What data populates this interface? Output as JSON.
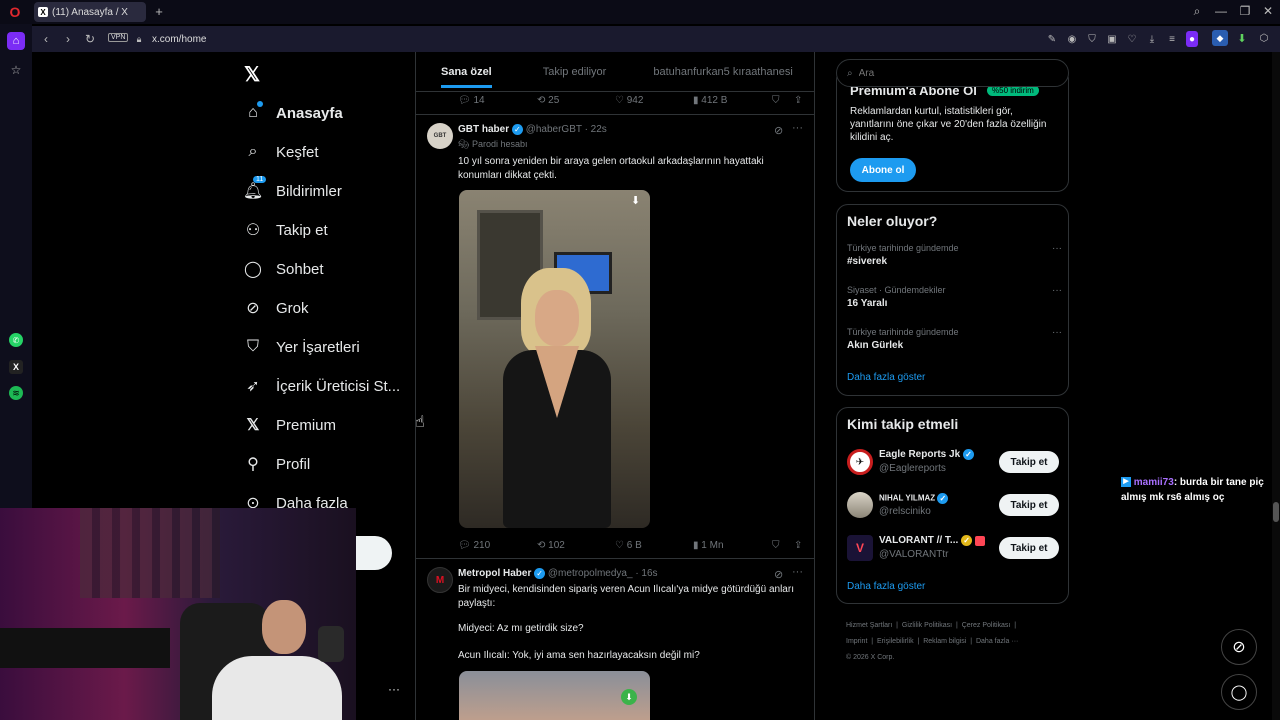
{
  "browser": {
    "tab_title": "(11) Anasayfa / X",
    "url": "x.com/home",
    "vpn_label": "VPN"
  },
  "nav": {
    "items": [
      {
        "label": "Anasayfa",
        "icon": "home-icon"
      },
      {
        "label": "Keşfet",
        "icon": "search-icon"
      },
      {
        "label": "Bildirimler",
        "icon": "bell-icon",
        "badge": "11"
      },
      {
        "label": "Takip et",
        "icon": "add-person-icon"
      },
      {
        "label": "Sohbet",
        "icon": "chat-icon"
      },
      {
        "label": "Grok",
        "icon": "grok-icon"
      },
      {
        "label": "Yer İşaretleri",
        "icon": "bookmark-icon"
      },
      {
        "label": "İçerik Üreticisi St...",
        "icon": "rocket-icon"
      },
      {
        "label": "Premium",
        "icon": "x-icon"
      },
      {
        "label": "Profil",
        "icon": "person-icon"
      },
      {
        "label": "Daha fazla",
        "icon": "more-circle-icon"
      }
    ]
  },
  "feed": {
    "tabs": [
      "Sana özel",
      "Takip ediliyor",
      "batuhanfurkan5 kıraathanesi"
    ],
    "top_actions": {
      "replies": "14",
      "retweets": "25",
      "likes": "942",
      "views": "412 B"
    },
    "tweet1": {
      "name": "GBT haber",
      "handle": "@haberGBT",
      "time": "· 22s",
      "label": "Parodi hesabı",
      "avatar_text": "GBT",
      "text": "10 yıl sonra yeniden bir araya gelen ortaokul arkadaşlarının hayattaki konumları dikkat çekti.",
      "replies": "210",
      "retweets": "102",
      "likes": "6 B",
      "views": "1 Mn"
    },
    "tweet2": {
      "name": "Metropol Haber",
      "handle": "@metropolmedya_",
      "time": "· 16s",
      "text1": "Bir midyeci, kendisinden sipariş veren Acun Ilıcalı'ya midye götürdüğü anları paylaştı:",
      "text2": "Midyeci: Az mı getirdik size?",
      "text3": "Acun Ilıcalı: Yok, iyi ama sen hazırlayacaksın değil mi?"
    }
  },
  "search": {
    "placeholder": "Ara"
  },
  "premium": {
    "title": "Premium'a Abone Ol",
    "badge": "%50 indirim",
    "text": "Reklamlardan kurtul, istatistikleri gör, yanıtlarını öne çıkar ve 20'den fazla özelliğin kilidini aç.",
    "button": "Abone ol"
  },
  "trends": {
    "title": "Neler oluyor?",
    "items": [
      {
        "category": "Türkiye tarihinde gündemde",
        "name": "#siverek"
      },
      {
        "category": "Siyaset · Gündemdekiler",
        "name": "16 Yaralı"
      },
      {
        "category": "Türkiye tarihinde gündemde",
        "name": "Akın Gürlek"
      }
    ],
    "more": "Daha fazla göster"
  },
  "who_to_follow": {
    "title": "Kimi takip etmeli",
    "items": [
      {
        "name": "Eagle Reports Jk",
        "handle": "@Eaglereports",
        "button": "Takip et"
      },
      {
        "name": "NIHAL YILMAZ",
        "handle": "@relsciniko",
        "button": "Takip et"
      },
      {
        "name": "VALORANT // T...",
        "handle": "@VALORANTtr",
        "button": "Takip et"
      }
    ],
    "more": "Daha fazla göster"
  },
  "footer": {
    "links": [
      "Hizmet Şartları",
      "Gizlilik Politikası",
      "Çerez Politikası",
      "Imprint",
      "Erişilebilirlik",
      "Reklam bilgisi",
      "Daha fazla ···"
    ],
    "copyright": "© 2026 X Corp."
  },
  "chat_overlay": {
    "user": "mamii73",
    "message": ": burda bir tane piç almış mk rs6 almış oç"
  },
  "colors": {
    "accent": "#1d9bf0",
    "background": "#000000",
    "border": "#2f3336"
  }
}
